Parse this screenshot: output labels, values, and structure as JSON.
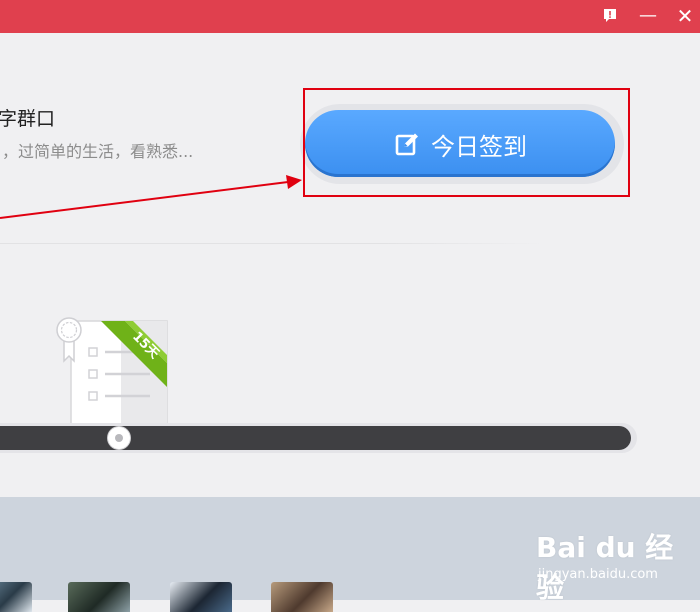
{
  "window": {
    "feedback_icon": "feedback-icon",
    "minimize_label": "—",
    "close_label": "✕",
    "titlebar_color": "#e0404e"
  },
  "group": {
    "name": "字群口",
    "description": "，过简单的生活，看熟悉..."
  },
  "checkin": {
    "label": "今日签到",
    "icon": "edit-icon",
    "color": "#3b8ff0"
  },
  "certificate": {
    "ribbon_text": "15天",
    "icon": "certificate-icon",
    "ribbon_color": "#6fb218"
  },
  "progress": {
    "position_fraction": 0.2
  },
  "avatars": [
    {
      "icon": "user-avatar"
    },
    {
      "icon": "user-avatar"
    },
    {
      "icon": "user-avatar"
    },
    {
      "icon": "user-avatar"
    }
  ],
  "watermark": {
    "logo": "Bai du 经验",
    "url": "jingyan.baidu.com"
  }
}
